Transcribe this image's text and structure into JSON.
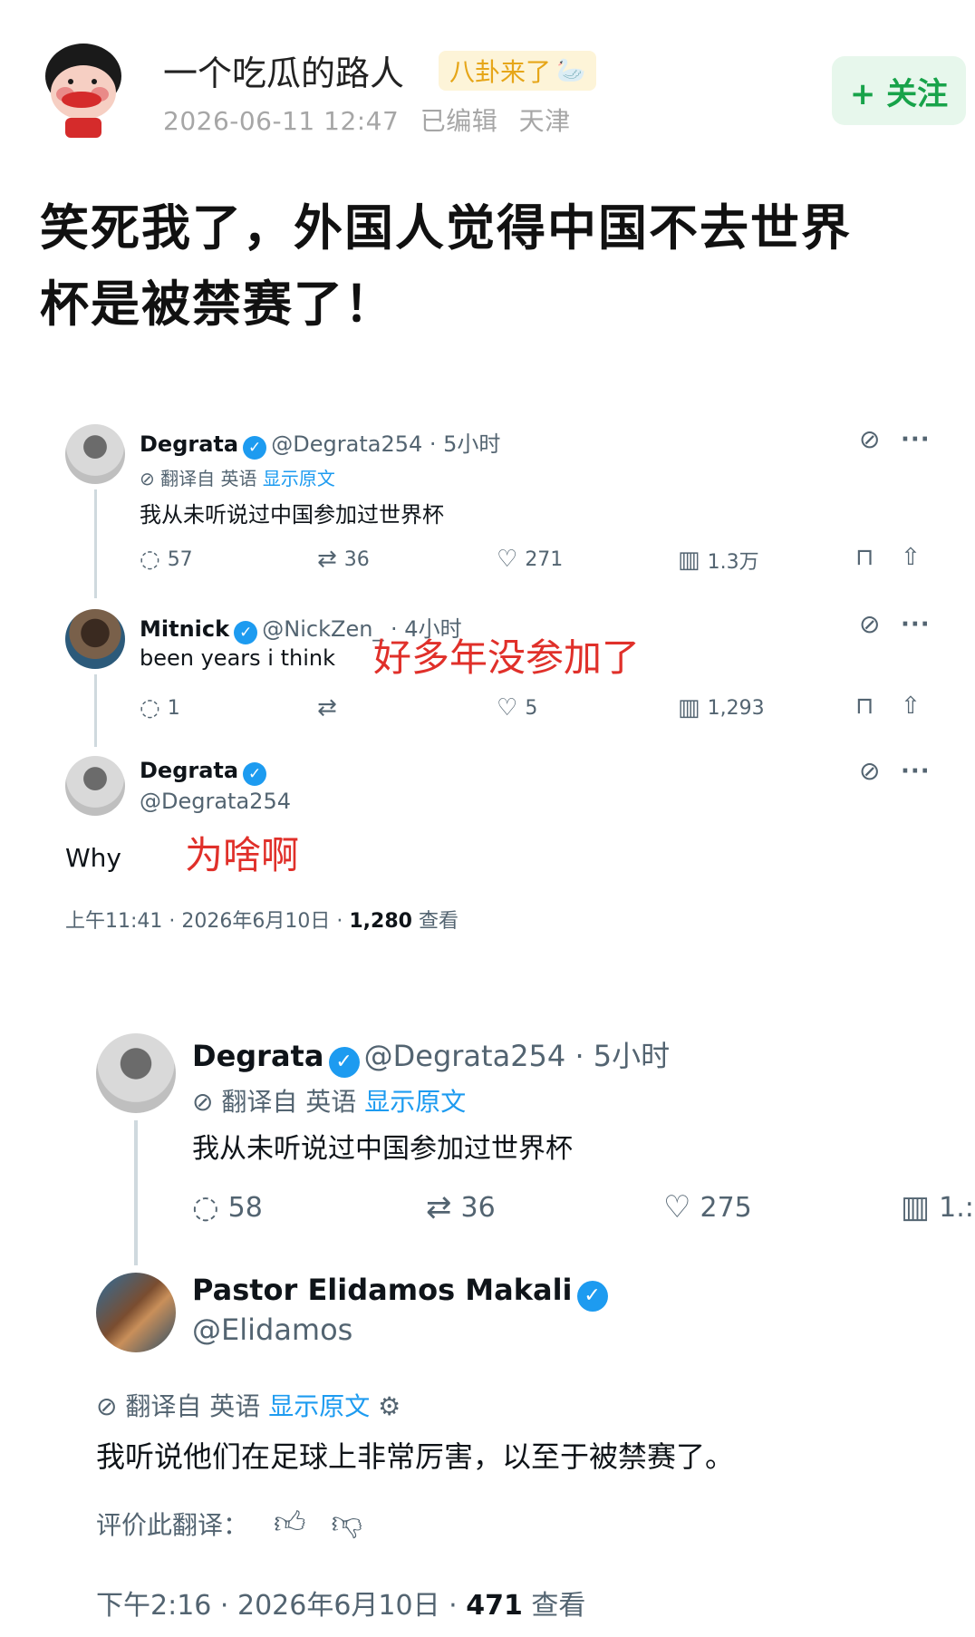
{
  "post": {
    "author": "一个吃瓜的路人",
    "tag": "八卦来了",
    "tag_icon": "goose-icon",
    "date": "2026-06-11 12:47",
    "edited": "已编辑",
    "location": "天津",
    "follow_label": "+ 关注",
    "headline_line1": "笑死我了，外国人觉得中国不去世界",
    "headline_line2": "杯是被禁赛了！"
  },
  "screenshot1": {
    "tweet1": {
      "name": "Degrata",
      "handle": "@Degrata254 · 5小时",
      "translated_from": "翻译自 英语",
      "show_original": "显示原文",
      "text": "我从未听说过中国参加过世界杯",
      "replies": "57",
      "retweets": "36",
      "likes": "271",
      "views": "1.3万"
    },
    "tweet2": {
      "name": "Mitnick",
      "handle": "@NickZen_ · 4小时",
      "text": "been years i think",
      "note": "好多年没参加了",
      "replies": "1",
      "retweets": "",
      "likes": "5",
      "views": "1,293"
    },
    "tweet3": {
      "name": "Degrata",
      "handle": "@Degrata254",
      "text": "Why",
      "note": "为啥啊",
      "time": "上午11:41 · 2026年6月10日 · ",
      "views_count": "1,280",
      "views_label": "查看"
    }
  },
  "screenshot2": {
    "tweet1": {
      "name": "Degrata",
      "handle": "@Degrata254 · 5小时",
      "translated_from": "翻译自 英语",
      "show_original": "显示原文",
      "text": "我从未听说过中国参加过世界杯",
      "replies": "58",
      "retweets": "36",
      "likes": "275",
      "views": "1.:"
    },
    "tweet2": {
      "name": "Pastor Elidamos Makali",
      "handle": "@Elidamos",
      "translated_from": "翻译自 英语",
      "show_original": "显示原文",
      "text": "我听说他们在足球上非常厉害，以至于被禁赛了。",
      "rate_label": "评价此翻译：",
      "time": "下午2:16 · 2026年6月10日 · ",
      "views_count": "471",
      "views_label": "查看"
    }
  }
}
